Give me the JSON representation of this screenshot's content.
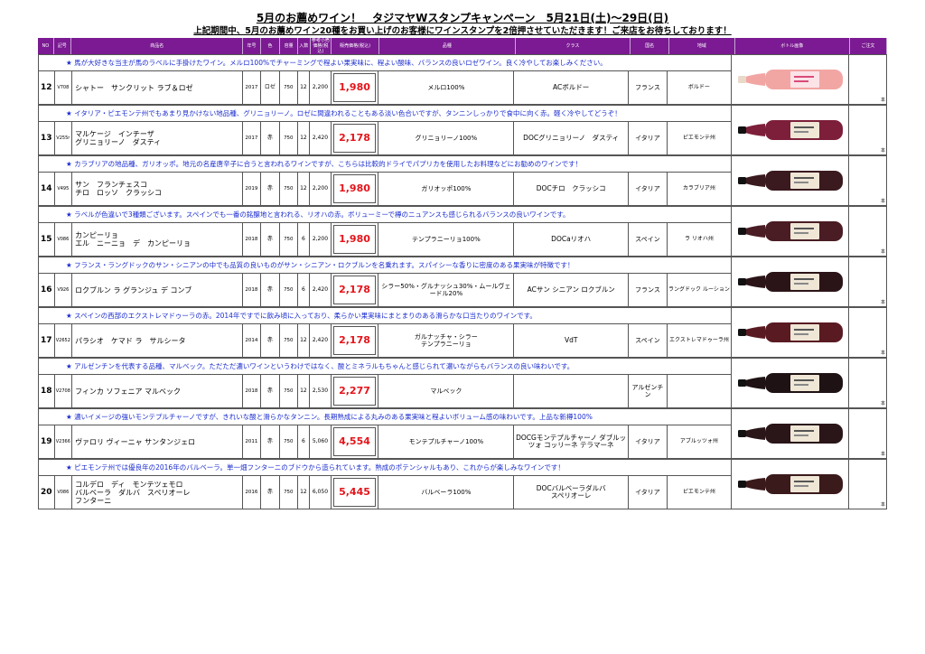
{
  "title": "5月のお薦めワイン！　タジマヤWスタンプキャンペーン　5月21日(土)～29日(日)",
  "subtitle": "上記期間中、5月のお薦めワイン20種をお買い上げのお客様にワインスタンプを2倍押させていただきます！ご来店をお待ちしております！",
  "headers": {
    "no": "NO",
    "code": "記号",
    "name": "商品名",
    "year": "年号",
    "color": "色",
    "volume": "容量",
    "qty": "入数",
    "price": "参考小売価格(税込)",
    "sale": "販売価格(税込)",
    "grape": "品種",
    "class": "クラス",
    "country": "国名",
    "region": "地域",
    "image": "ボトル画像",
    "order": "ご注文"
  },
  "unit_label": "本",
  "rows": [
    {
      "note": "★ 馬が大好きな当主が馬のラベルに手掛けたワイン。メルロ100%でチャーミングで程よい果実味に、程よい酸味、バランスの良いロゼワイン。良く冷やしてお楽しみください。",
      "no": "12",
      "code": "V708",
      "name": "シャトー　サンクリット ラブ＆ロゼ",
      "year": "2017",
      "color": "ロゼ",
      "volume": "750",
      "qty": "12",
      "price": "2,200",
      "sale": "1,980",
      "grape": "メルロ100%",
      "class": "ACボルドー",
      "country": "フランス",
      "region": "ボルドー",
      "bottle_color": "#f2a6a4",
      "bottle_type": "rose"
    },
    {
      "note": "★ イタリア・ピエモンテ州でもあまり見かけない地品種、グリニョリーノ。ロゼに間違われることもある淡い色合いですが、タンニンしっかりで食中に向く赤。軽く冷やしてどうぞ！",
      "no": "13",
      "code": "V255r",
      "name": "マルケージ　インチーザ\nグリニョリーノ　ダスティ",
      "year": "2017",
      "color": "赤",
      "volume": "750",
      "qty": "12",
      "price": "2,420",
      "sale": "2,178",
      "grape": "グリニョリーノ100%",
      "class": "DOCグリニョリーノ　ダスティ",
      "country": "イタリア",
      "region": "ピエモンテ州",
      "bottle_color": "#7d1f3a",
      "bottle_type": "red"
    },
    {
      "note": "★ カラブリアの地品種、ガリオッポ。地元の名産唐辛子に合うと言われるワインですが、こちらは比較的ドライでパプリカを使用したお料理などにお勧めのワインです！",
      "no": "14",
      "code": "V495",
      "name": "サン　フランチェスコ\nチロ　ロッソ　クラッシコ",
      "year": "2019",
      "color": "赤",
      "volume": "750",
      "qty": "12",
      "price": "2,200",
      "sale": "1,980",
      "grape": "ガリオッポ100%",
      "class": "DOCチロ　クラッシコ",
      "country": "イタリア",
      "region": "カラブリア州",
      "bottle_color": "#3a1a1f",
      "bottle_type": "red"
    },
    {
      "note": "★ ラベルが色違いで3種類ございます。スペインでも一番の銘醸地と言われる、リオハの赤。ボリューミーで樽のニュアンスも感じられるバランスの良いワインです。",
      "no": "15",
      "code": "V086",
      "name": "カンピーリョ\nエル　ニーニョ　デ　カンピーリョ",
      "year": "2018",
      "color": "赤",
      "volume": "750",
      "qty": "6",
      "price": "2,200",
      "sale": "1,980",
      "grape": "テンプラニーリョ100%",
      "class": "DOCaリオハ",
      "country": "スペイン",
      "region": "ラ リオハ州",
      "bottle_color": "#4a1c24",
      "bottle_type": "red"
    },
    {
      "note": "★ フランス・ラングドックのサン・シニアンの中でも品質の良いものがサン・シニアン・ロクブルンを名乗れます。スパイシーな香りに密度のある果実味が特徴です！",
      "no": "16",
      "code": "V926",
      "name": "ロクブルン ラ グランジュ デ コンブ",
      "year": "2018",
      "color": "赤",
      "volume": "750",
      "qty": "6",
      "price": "2,420",
      "sale": "2,178",
      "grape": "シラー50%・グルナッシュ30%・ムールヴェードル20%",
      "class": "ACサン シニアン ロクブルン",
      "country": "フランス",
      "region": "ラングドック ルーション",
      "bottle_color": "#2b1418",
      "bottle_type": "red"
    },
    {
      "note": "★ スペインの西部のエクストレマドゥーラの赤。2014年ですでに飲み頃に入っており、柔らかい果実味にまとまりのある滑らかな口当たりのワインです。",
      "no": "17",
      "code": "V2652",
      "name": "パラシオ　ケマド ラ　サルシータ",
      "year": "2014",
      "color": "赤",
      "volume": "750",
      "qty": "12",
      "price": "2,420",
      "sale": "2,178",
      "grape": "ガルナッチャ・シラー\nテンプラニーリョ",
      "class": "VdT",
      "country": "スペイン",
      "region": "エクストレマドゥーラ州",
      "bottle_color": "#5a1a22",
      "bottle_type": "red"
    },
    {
      "note": "★ アルゼンチンを代表する品種、マルベック。ただただ濃いワインというわけではなく、酸とミネラルもちゃんと感じられて濃いながらもバランスの良い味わいです。",
      "no": "18",
      "code": "V2708",
      "name": "フィンカ ソフェニア マルベック",
      "year": "2018",
      "color": "赤",
      "volume": "750",
      "qty": "12",
      "price": "2,530",
      "sale": "2,277",
      "grape": "マルベック",
      "class": "",
      "country": "アルゼンチン",
      "region": "",
      "bottle_color": "#1f1214",
      "bottle_type": "red"
    },
    {
      "note": "★ 濃いイメージの強いモンテプルチャーノですが、きれいな酸と滑らかなタンニン。長期熟成による丸みのある果実味と程よいボリューム感の味わいです。上品な新樽100%",
      "no": "19",
      "code": "V2366",
      "name": "ヴァロリ ヴィーニャ サンタンジェロ",
      "year": "2011",
      "color": "赤",
      "volume": "750",
      "qty": "6",
      "price": "5,060",
      "sale": "4,554",
      "grape": "モンテプルチャーノ100%",
      "class": "DOCGモンテプルチャーノ ダブルッツォ コッリーネ テラマーネ",
      "country": "イタリア",
      "region": "アブルッツォ州",
      "bottle_color": "#2a1519",
      "bottle_type": "red"
    },
    {
      "note": "★ ピエモンテ州では優良年の2016年のバルベーラ。単一畑フンターニのブドウから造られています。熟成のポテンシャルもあり、これからが楽しみなワインです！",
      "no": "20",
      "code": "V086",
      "name": "コルデロ　ディ　モンテツェモロ\nバルベーラ　ダルバ　スペリオーレ\nフンターニ",
      "year": "2016",
      "color": "赤",
      "volume": "750",
      "qty": "12",
      "price": "6,050",
      "sale": "5,445",
      "grape": "バルベーラ100%",
      "class": "DOCバルベーラダルバ\nスペリオーレ",
      "country": "イタリア",
      "region": "ピエモンテ州",
      "bottle_color": "#3b1a1c",
      "bottle_type": "red"
    }
  ]
}
